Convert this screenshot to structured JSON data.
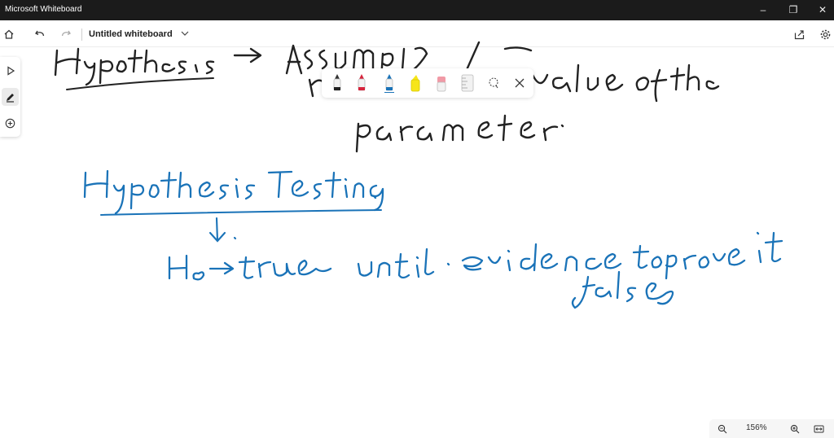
{
  "app": {
    "title": "Microsoft Whiteboard"
  },
  "window_controls": {
    "minimize": "–",
    "restore": "❐",
    "close": "✕"
  },
  "toolbar": {
    "board_title": "Untitled whiteboard"
  },
  "pen_tray": {
    "pens": [
      "black-pen",
      "red-pen",
      "blue-pen",
      "yellow-highlighter",
      "eraser",
      "ruler",
      "lasso"
    ],
    "selected": "blue-pen"
  },
  "zoom": {
    "level": "156%"
  },
  "canvas": {
    "note_color": "#1a73b8",
    "top_ink_color": "#222222",
    "handwritten_notes": [
      "Hypothesis → Assumption / claim regarding the value of the parameter",
      "Hypothesis Testing",
      "H₀ → true until evidence to prove it false"
    ]
  },
  "colors": {
    "titlebar": "#1b1b1b",
    "accent": "#1a73b8",
    "ink_dark": "#222222"
  }
}
